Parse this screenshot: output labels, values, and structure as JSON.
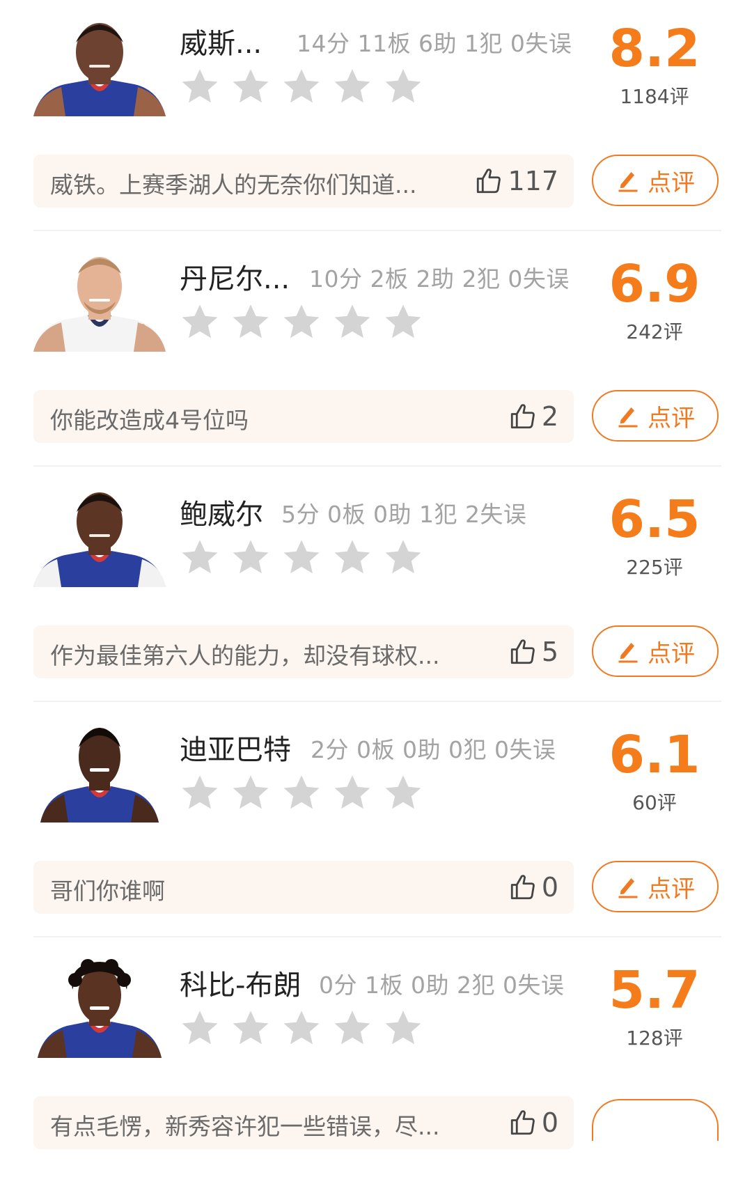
{
  "colors": {
    "accent": "#f47c1a",
    "star": "#d4d4d4",
    "comment_bg": "#fdf5ef",
    "stat_text": "#a3a3a3"
  },
  "icons": {
    "star": "star-icon",
    "like": "thumbs-up-icon",
    "review": "pen-icon"
  },
  "players": [
    {
      "name": "威斯...",
      "stats": "14分 11板 6助 1犯 0失误",
      "score": "8.2",
      "review_count": "1184评",
      "stars_filled": 0,
      "comment": "威铁。上赛季湖人的无奈你们知道...",
      "likes": "117",
      "review_button": "点评"
    },
    {
      "name": "丹尼尔...",
      "stats": "10分 2板 2助 2犯 0失误",
      "score": "6.9",
      "review_count": "242评",
      "stars_filled": 0,
      "comment": "你能改造成4号位吗",
      "likes": "2",
      "review_button": "点评"
    },
    {
      "name": "鲍威尔",
      "stats": "5分 0板 0助 1犯 2失误",
      "score": "6.5",
      "review_count": "225评",
      "stars_filled": 0,
      "comment": "作为最佳第六人的能力，却没有球权...",
      "likes": "5",
      "review_button": "点评"
    },
    {
      "name": "迪亚巴特",
      "stats": "2分 0板 0助 0犯 0失误",
      "score": "6.1",
      "review_count": "60评",
      "stars_filled": 0,
      "comment": "哥们你谁啊",
      "likes": "0",
      "review_button": "点评"
    },
    {
      "name": "科比-布朗",
      "stats": "0分 1板 0助 2犯 0失误",
      "score": "5.7",
      "review_count": "128评",
      "stars_filled": 0,
      "comment": "有点毛愣，新秀容许犯一些错误，尽...",
      "likes": "0",
      "review_button": ""
    }
  ]
}
